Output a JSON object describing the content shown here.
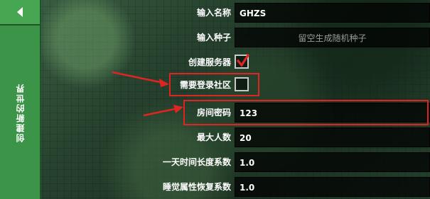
{
  "sidebar": {
    "back_icon": "chevron-left-icon",
    "tab_label": "创建新的世界"
  },
  "form": {
    "name": {
      "label": "输入名称",
      "value": "GHZS"
    },
    "seed": {
      "label": "输入种子",
      "placeholder": "留空生成随机种子"
    },
    "server": {
      "label": "创建服务器",
      "checked": true
    },
    "community": {
      "label": "需要登录社区",
      "checked": false
    },
    "password": {
      "label": "房间密码",
      "value": "123"
    },
    "max_players": {
      "label": "最大人数",
      "value": "20"
    },
    "day_length": {
      "label": "一天时间长度系数",
      "value": "1.0"
    },
    "sleep_recovery": {
      "label": "睡觉属性恢复系数",
      "value": "1.0"
    }
  },
  "colors": {
    "sidebar": "#2f7d3c",
    "highlight": "#e02424",
    "check": "#e02424"
  }
}
